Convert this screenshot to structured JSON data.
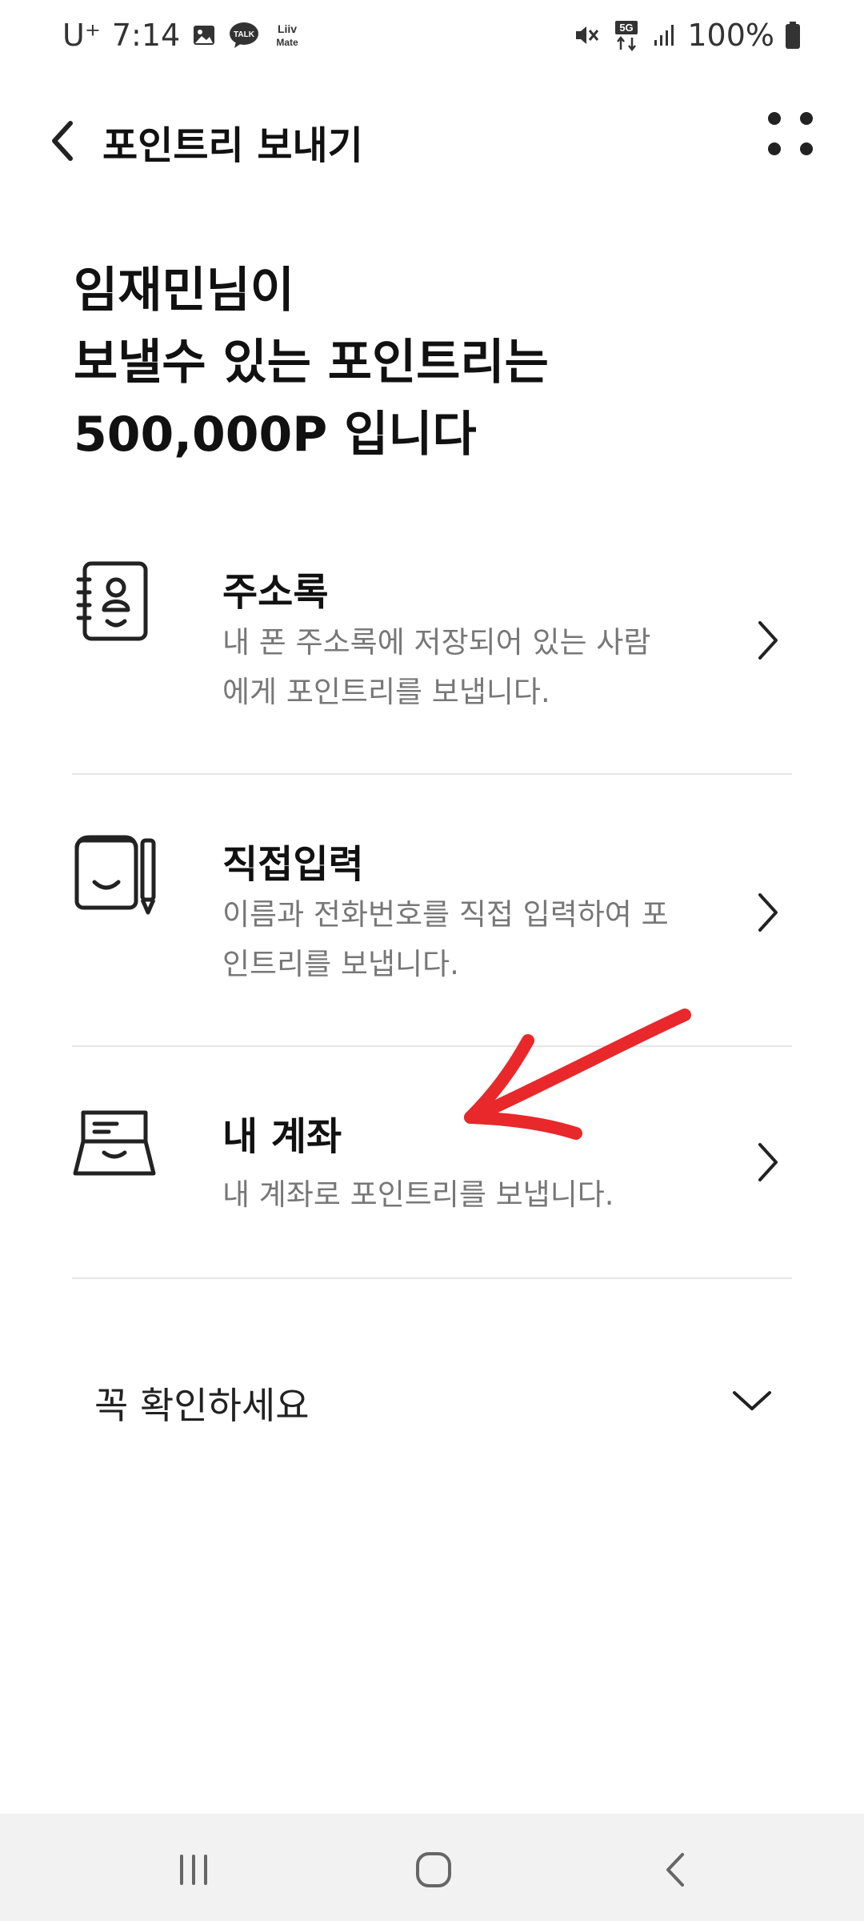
{
  "status_bar": {
    "carrier": "U⁺",
    "time": "7:14",
    "battery": "100%",
    "network": "5G",
    "icons_left": [
      "gallery-icon",
      "talk-icon",
      "liiv-mate-icon"
    ],
    "icons_right": [
      "mute-icon",
      "5g-icon",
      "signal-icon",
      "battery-icon"
    ],
    "talk_label": "TALK",
    "liiv_label_1": "Liiv",
    "liiv_label_2": "Mate"
  },
  "header": {
    "title": "포인트리 보내기"
  },
  "headline": {
    "line1": "임재민님이",
    "line2": "보낼수 있는 포인트리는",
    "line3": "500,000P 입니다"
  },
  "options": [
    {
      "title": "주소록",
      "desc_line1": "내 폰 주소록에 저장되어 있는 사람",
      "desc_line2": "에게 포인트리를 보냅니다.",
      "icon": "address-book-icon"
    },
    {
      "title": "직접입력",
      "desc_line1": "이름과 전화번호를 직접 입력하여 포",
      "desc_line2": "인트리를 보냅니다.",
      "icon": "notebook-pen-icon"
    },
    {
      "title": "내 계좌",
      "desc_line1": "내 계좌로 포인트리를 보냅니다.",
      "icon": "account-card-icon"
    }
  ],
  "notice": {
    "label": "꼭 확인하세요"
  },
  "colors": {
    "annotation_red": "#e8282b",
    "text_primary": "#111111",
    "text_secondary": "#777777",
    "divider": "#e6e6e6",
    "nav_bg": "#f2f2f2"
  }
}
